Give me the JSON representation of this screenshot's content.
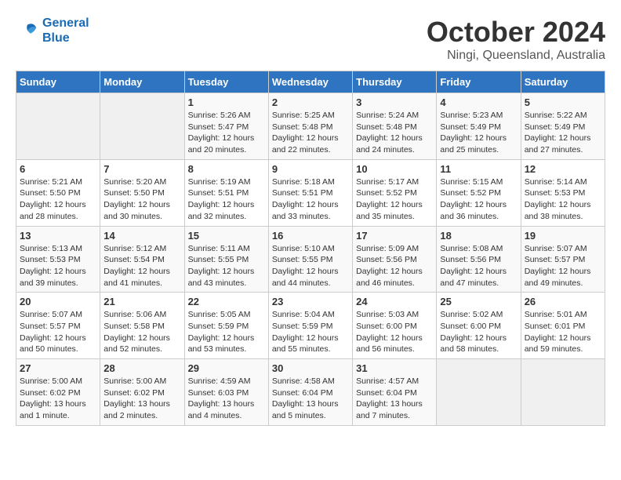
{
  "header": {
    "logo_line1": "General",
    "logo_line2": "Blue",
    "month": "October 2024",
    "location": "Ningi, Queensland, Australia"
  },
  "days_of_week": [
    "Sunday",
    "Monday",
    "Tuesday",
    "Wednesday",
    "Thursday",
    "Friday",
    "Saturday"
  ],
  "weeks": [
    [
      {
        "day": "",
        "empty": true
      },
      {
        "day": "",
        "empty": true
      },
      {
        "day": "1",
        "sunrise": "5:26 AM",
        "sunset": "5:47 PM",
        "daylight": "12 hours and 20 minutes."
      },
      {
        "day": "2",
        "sunrise": "5:25 AM",
        "sunset": "5:48 PM",
        "daylight": "12 hours and 22 minutes."
      },
      {
        "day": "3",
        "sunrise": "5:24 AM",
        "sunset": "5:48 PM",
        "daylight": "12 hours and 24 minutes."
      },
      {
        "day": "4",
        "sunrise": "5:23 AM",
        "sunset": "5:49 PM",
        "daylight": "12 hours and 25 minutes."
      },
      {
        "day": "5",
        "sunrise": "5:22 AM",
        "sunset": "5:49 PM",
        "daylight": "12 hours and 27 minutes."
      }
    ],
    [
      {
        "day": "6",
        "sunrise": "5:21 AM",
        "sunset": "5:50 PM",
        "daylight": "12 hours and 28 minutes."
      },
      {
        "day": "7",
        "sunrise": "5:20 AM",
        "sunset": "5:50 PM",
        "daylight": "12 hours and 30 minutes."
      },
      {
        "day": "8",
        "sunrise": "5:19 AM",
        "sunset": "5:51 PM",
        "daylight": "12 hours and 32 minutes."
      },
      {
        "day": "9",
        "sunrise": "5:18 AM",
        "sunset": "5:51 PM",
        "daylight": "12 hours and 33 minutes."
      },
      {
        "day": "10",
        "sunrise": "5:17 AM",
        "sunset": "5:52 PM",
        "daylight": "12 hours and 35 minutes."
      },
      {
        "day": "11",
        "sunrise": "5:15 AM",
        "sunset": "5:52 PM",
        "daylight": "12 hours and 36 minutes."
      },
      {
        "day": "12",
        "sunrise": "5:14 AM",
        "sunset": "5:53 PM",
        "daylight": "12 hours and 38 minutes."
      }
    ],
    [
      {
        "day": "13",
        "sunrise": "5:13 AM",
        "sunset": "5:53 PM",
        "daylight": "12 hours and 39 minutes."
      },
      {
        "day": "14",
        "sunrise": "5:12 AM",
        "sunset": "5:54 PM",
        "daylight": "12 hours and 41 minutes."
      },
      {
        "day": "15",
        "sunrise": "5:11 AM",
        "sunset": "5:55 PM",
        "daylight": "12 hours and 43 minutes."
      },
      {
        "day": "16",
        "sunrise": "5:10 AM",
        "sunset": "5:55 PM",
        "daylight": "12 hours and 44 minutes."
      },
      {
        "day": "17",
        "sunrise": "5:09 AM",
        "sunset": "5:56 PM",
        "daylight": "12 hours and 46 minutes."
      },
      {
        "day": "18",
        "sunrise": "5:08 AM",
        "sunset": "5:56 PM",
        "daylight": "12 hours and 47 minutes."
      },
      {
        "day": "19",
        "sunrise": "5:07 AM",
        "sunset": "5:57 PM",
        "daylight": "12 hours and 49 minutes."
      }
    ],
    [
      {
        "day": "20",
        "sunrise": "5:07 AM",
        "sunset": "5:57 PM",
        "daylight": "12 hours and 50 minutes."
      },
      {
        "day": "21",
        "sunrise": "5:06 AM",
        "sunset": "5:58 PM",
        "daylight": "12 hours and 52 minutes."
      },
      {
        "day": "22",
        "sunrise": "5:05 AM",
        "sunset": "5:59 PM",
        "daylight": "12 hours and 53 minutes."
      },
      {
        "day": "23",
        "sunrise": "5:04 AM",
        "sunset": "5:59 PM",
        "daylight": "12 hours and 55 minutes."
      },
      {
        "day": "24",
        "sunrise": "5:03 AM",
        "sunset": "6:00 PM",
        "daylight": "12 hours and 56 minutes."
      },
      {
        "day": "25",
        "sunrise": "5:02 AM",
        "sunset": "6:00 PM",
        "daylight": "12 hours and 58 minutes."
      },
      {
        "day": "26",
        "sunrise": "5:01 AM",
        "sunset": "6:01 PM",
        "daylight": "12 hours and 59 minutes."
      }
    ],
    [
      {
        "day": "27",
        "sunrise": "5:00 AM",
        "sunset": "6:02 PM",
        "daylight": "13 hours and 1 minute."
      },
      {
        "day": "28",
        "sunrise": "5:00 AM",
        "sunset": "6:02 PM",
        "daylight": "13 hours and 2 minutes."
      },
      {
        "day": "29",
        "sunrise": "4:59 AM",
        "sunset": "6:03 PM",
        "daylight": "13 hours and 4 minutes."
      },
      {
        "day": "30",
        "sunrise": "4:58 AM",
        "sunset": "6:04 PM",
        "daylight": "13 hours and 5 minutes."
      },
      {
        "day": "31",
        "sunrise": "4:57 AM",
        "sunset": "6:04 PM",
        "daylight": "13 hours and 7 minutes."
      },
      {
        "day": "",
        "empty": true
      },
      {
        "day": "",
        "empty": true
      }
    ]
  ]
}
